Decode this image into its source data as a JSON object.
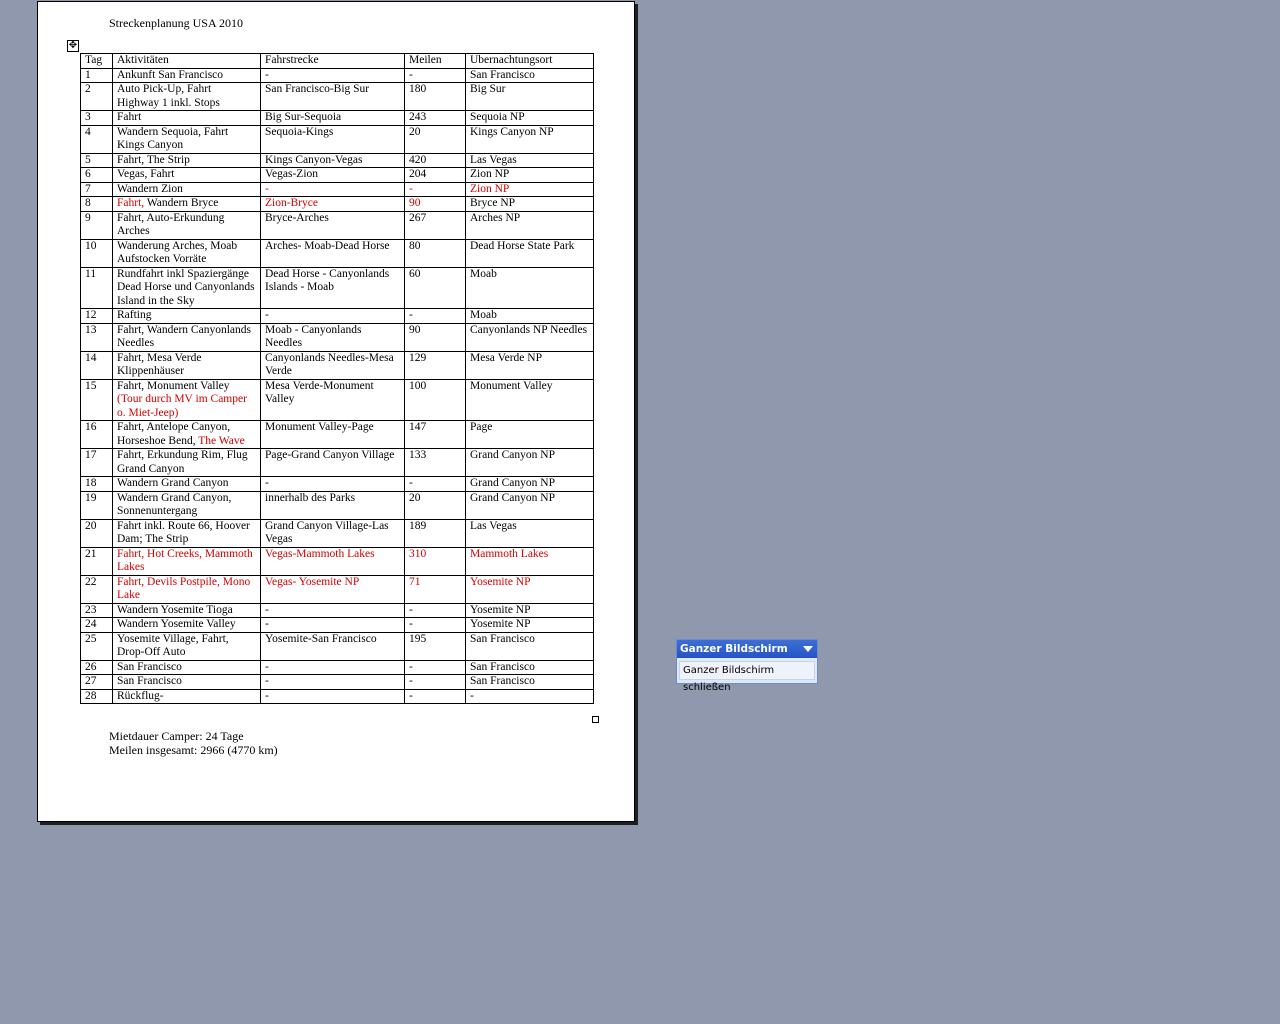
{
  "document": {
    "title": "Streckenplanung USA 2010",
    "move_handle_glyph": "✥",
    "table": {
      "headers": [
        "Tag",
        "Aktivitäten",
        "Fahrstrecke",
        "Meilen",
        "Ubernachtungsort"
      ],
      "rows": [
        {
          "tag": "1",
          "act": "Ankunft San Francisco",
          "route": "-",
          "miles": "-",
          "stay": "San Francisco"
        },
        {
          "tag": "2",
          "act": "Auto Pick-Up, Fahrt Highway 1 inkl. Stops",
          "route": "San Francisco-Big Sur",
          "miles": "180",
          "stay": "Big Sur"
        },
        {
          "tag": "3",
          "act": "Fahrt",
          "route": "Big Sur-Sequoia",
          "miles": "243",
          "stay": "Sequoia NP"
        },
        {
          "tag": "4",
          "act": "Wandern Sequoia, Fahrt Kings Canyon",
          "route": "Sequoia-Kings",
          "miles": "20",
          "stay": "Kings Canyon NP"
        },
        {
          "tag": "5",
          "act": "Fahrt, The Strip",
          "route": "Kings Canyon-Vegas",
          "miles": "420",
          "stay": "Las Vegas"
        },
        {
          "tag": "6",
          "act": "Vegas, Fahrt",
          "route": "Vegas-Zion",
          "miles": "204",
          "stay": "Zion NP"
        },
        {
          "tag": "7",
          "act": "Wandern Zion",
          "route": "-",
          "miles": "-",
          "stay": "Zion NP",
          "red": [
            "route",
            "miles",
            "stay"
          ]
        },
        {
          "tag": "8",
          "act_red": "Fahrt,",
          "act_rest": " Wandern Bryce",
          "route": "Zion-Bryce",
          "miles": "90",
          "stay": "Bryce NP",
          "red": [
            "route",
            "miles"
          ]
        },
        {
          "tag": "9",
          "act": "Fahrt, Auto-Erkundung Arches",
          "route": "Bryce-Arches",
          "miles": "267",
          "stay": "Arches NP"
        },
        {
          "tag": "10",
          "act": "Wanderung Arches, Moab Aufstocken Vorräte",
          "route": "Arches- Moab-Dead Horse",
          "miles": "80",
          "stay": "Dead Horse State Park"
        },
        {
          "tag": "11",
          "act": "Rundfahrt inkl Spaziergänge Dead Horse und Canyonlands Island in the Sky",
          "route": "Dead Horse - Canyonlands Islands - Moab",
          "miles": "60",
          "stay": "Moab"
        },
        {
          "tag": "12",
          "act": "Rafting",
          "route": "-",
          "miles": "-",
          "stay": "Moab"
        },
        {
          "tag": "13",
          "act": "Fahrt, Wandern Canyonlands Needles",
          "route": "Moab - Canyonlands Needles",
          "miles": "90",
          "stay": "Canyonlands NP Needles"
        },
        {
          "tag": "14",
          "act": "Fahrt, Mesa Verde Klippenhäuser",
          "route": "Canyonlands Needles-Mesa Verde",
          "miles": "129",
          "stay": "Mesa Verde NP"
        },
        {
          "tag": "15",
          "act": "Fahrt, Monument Valley ",
          "act_red_tail": "(Tour durch MV im Camper o. Miet-Jeep)",
          "route": "Mesa Verde-Monument Valley",
          "miles": "100",
          "stay": "Monument Valley"
        },
        {
          "tag": "16",
          "act": "Fahrt, Antelope Canyon, Horseshoe Bend, ",
          "act_red_tail": "The Wave",
          "route": "Monument Valley-Page",
          "miles": "147",
          "stay": "Page"
        },
        {
          "tag": "17",
          "act": "Fahrt, Erkundung Rim, Flug Grand Canyon",
          "route": "Page-Grand Canyon Village",
          "miles": "133",
          "stay": "Grand Canyon NP"
        },
        {
          "tag": "18",
          "act": "Wandern Grand Canyon",
          "route": "-",
          "miles": "-",
          "stay": "Grand Canyon NP"
        },
        {
          "tag": "19",
          "act": "Wandern Grand Canyon, Sonnenuntergang",
          "route": "innerhalb des Parks",
          "miles": "20",
          "stay": "Grand Canyon NP"
        },
        {
          "tag": "20",
          "act": "Fahrt inkl. Route 66, Hoover Dam; The Strip",
          "route": "Grand Canyon Village-Las Vegas",
          "miles": "189",
          "stay": "Las Vegas"
        },
        {
          "tag": "21",
          "act": "Fahrt, Hot Creeks, Mammoth Lakes",
          "route": "Vegas-Mammoth Lakes",
          "miles": "310",
          "stay": "Mammoth Lakes",
          "red": [
            "act",
            "route",
            "miles",
            "stay"
          ]
        },
        {
          "tag": "22",
          "act": "Fahrt, Devils Postpile, Mono Lake",
          "route": "Vegas- Yosemite NP",
          "miles": "71",
          "stay": "Yosemite NP",
          "red": [
            "act",
            "route",
            "miles",
            "stay"
          ]
        },
        {
          "tag": "23",
          "act": "Wandern Yosemite Tioga",
          "route": "-",
          "miles": "-",
          "stay": "Yosemite NP"
        },
        {
          "tag": "24",
          "act": "Wandern Yosemite Valley",
          "route": "-",
          "miles": "-",
          "stay": "Yosemite NP"
        },
        {
          "tag": "25",
          "act": "Yosemite Village, Fahrt, Drop-Off Auto",
          "route": "Yosemite-San Francisco",
          "miles": "195",
          "stay": "San Francisco"
        },
        {
          "tag": "26",
          "act": "San Francisco",
          "route": "-",
          "miles": "-",
          "stay": "San Francisco"
        },
        {
          "tag": "27",
          "act": "San Francisco",
          "route": "-",
          "miles": "-",
          "stay": "San Francisco"
        },
        {
          "tag": "28",
          "act": "Rückflug-",
          "route": "-",
          "miles": "-",
          "stay": "-"
        }
      ]
    },
    "summary_line1": "Mietdauer Camper: 24 Tage",
    "summary_line2": "Meilen insgesamt: 2966 (4770 km)"
  },
  "fullscreen_toolbar": {
    "title": "Ganzer Bildschirm",
    "close_label": "Ganzer Bildschirm schließen"
  },
  "colors": {
    "desktop": "#8f98ac",
    "highlight_red": "#d40000",
    "toolbar_title": "#2454c5"
  }
}
